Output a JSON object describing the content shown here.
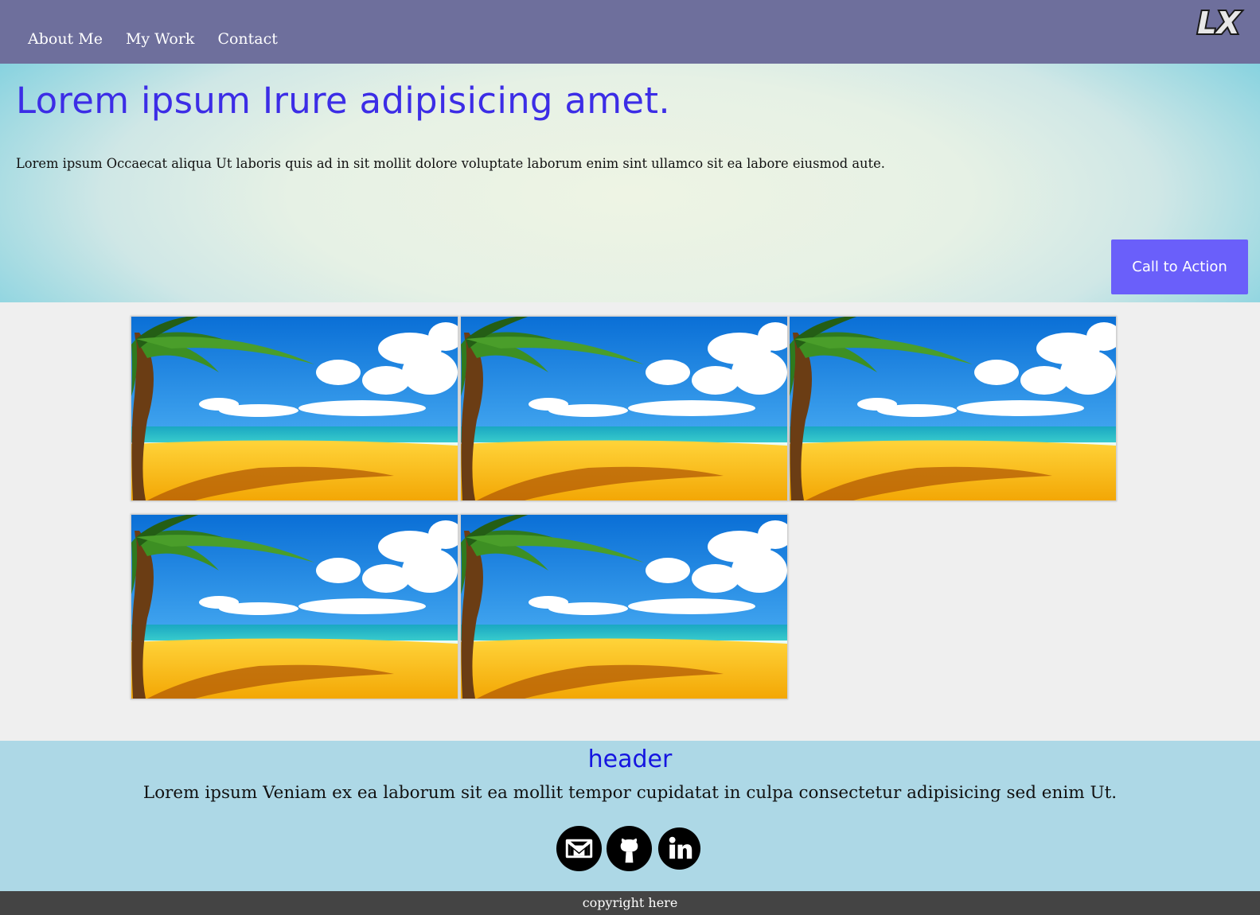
{
  "nav": {
    "links": [
      "About Me",
      "My Work",
      "Contact"
    ],
    "logo_text": "LX",
    "background": "#6e6f9c"
  },
  "hero": {
    "title": "Lorem ipsum Irure adipisicing amet.",
    "text": "Lorem ipsum Occaecat aliqua Ut laboris quis ad in sit mollit dolore voluptate laborum enim sint ullamco sit ea labore eiusmod aute.",
    "cta_label": "Call to Action",
    "title_color": "#3c2de6",
    "cta_color": "#6a5ffa"
  },
  "gallery": {
    "image_subject": "tropical beach with palm tree",
    "count": 5
  },
  "footer": {
    "header": "header",
    "text": "Lorem ipsum Veniam ex ea laborum sit ea mollit tempor cupidatat in culpa consectetur adipisicing sed enim Ut.",
    "social_icons": [
      "gmail-icon",
      "github-icon",
      "linkedin-icon"
    ],
    "background": "#add8e6"
  },
  "copyright": "copyright here"
}
